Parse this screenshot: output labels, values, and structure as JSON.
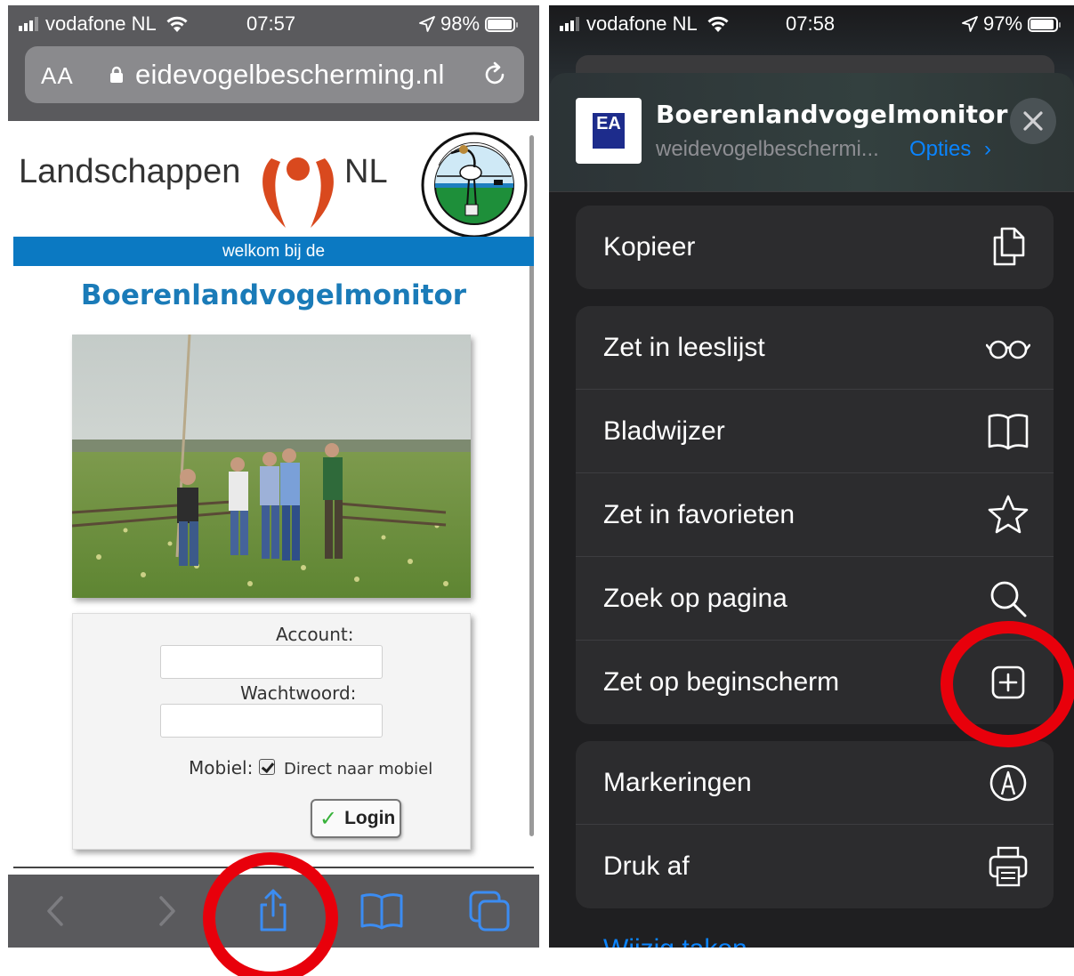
{
  "left_phone": {
    "status": {
      "carrier": "vodafone NL",
      "time": "07:57",
      "battery": "98%"
    },
    "urlbar": {
      "text_size_label": "AA",
      "url": "eidevogelbescherming.nl"
    },
    "page": {
      "logo_name": "Landschappen",
      "logo_suffix": "NL",
      "banner": "welkom bij de",
      "title": "Boerenlandvogelmonitor",
      "form": {
        "account_label": "Account:",
        "account_value": "",
        "password_label": "Wachtwoord:",
        "password_value": "",
        "mobile_label": "Mobiel:",
        "checkbox_label": "Direct naar mobiel",
        "checkbox_checked": true,
        "login_label": "Login"
      }
    },
    "toolbar": {
      "icons": [
        "back-icon",
        "forward-icon",
        "share-icon",
        "bookmarks-icon",
        "tabs-icon"
      ]
    }
  },
  "right_phone": {
    "status": {
      "carrier": "vodafone NL",
      "time": "07:58",
      "battery": "97%"
    },
    "sheet": {
      "app_icon_label": "EA",
      "title": "Boerenlandvogelmonitor",
      "subtitle": "weidevogelbeschermi...",
      "options_label": "Opties",
      "options_chevron": "›"
    },
    "groups": [
      {
        "items": [
          {
            "label": "Kopieer",
            "icon": "copy-icon"
          }
        ]
      },
      {
        "items": [
          {
            "label": "Zet in leeslijst",
            "icon": "glasses-icon"
          },
          {
            "label": "Bladwijzer",
            "icon": "book-icon"
          },
          {
            "label": "Zet in favorieten",
            "icon": "star-icon"
          },
          {
            "label": "Zoek op pagina",
            "icon": "search-icon"
          },
          {
            "label": "Zet op beginscherm",
            "icon": "add-square-icon"
          }
        ]
      },
      {
        "items": [
          {
            "label": "Markeringen",
            "icon": "markup-icon"
          },
          {
            "label": "Druk af",
            "icon": "printer-icon"
          }
        ]
      }
    ],
    "edit_actions_label": "Wijzig taken"
  },
  "colors": {
    "highlight_ring": "#e8000b",
    "ios_blue": "#0a84ff",
    "site_blue": "#0b79c2"
  }
}
